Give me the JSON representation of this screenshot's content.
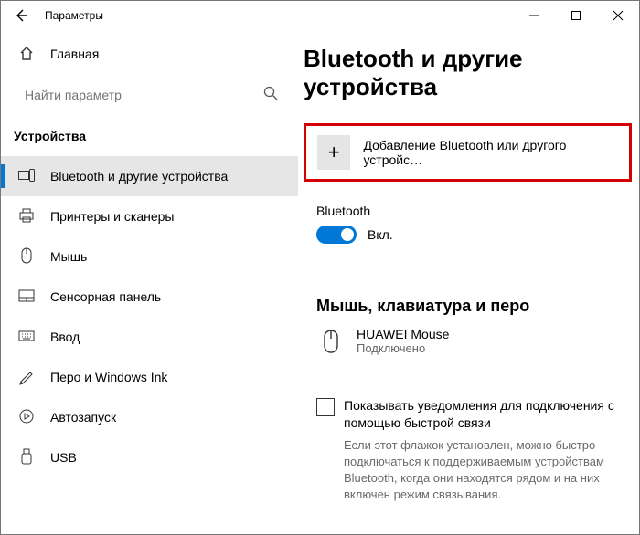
{
  "titlebar": {
    "app_title": "Параметры"
  },
  "sidebar": {
    "home_label": "Главная",
    "search_placeholder": "Найти параметр",
    "category": "Устройства",
    "items": [
      {
        "label": "Bluetooth и другие устройства",
        "active": true
      },
      {
        "label": "Принтеры и сканеры"
      },
      {
        "label": "Мышь"
      },
      {
        "label": "Сенсорная панель"
      },
      {
        "label": "Ввод"
      },
      {
        "label": "Перо и Windows Ink"
      },
      {
        "label": "Автозапуск"
      },
      {
        "label": "USB"
      }
    ]
  },
  "main": {
    "heading": "Bluetooth и другие устройства",
    "add_device_label": "Добавление Bluetooth или другого устройс…",
    "bt_section": "Bluetooth",
    "bt_state": "Вкл.",
    "mkp_heading": "Мышь, клавиатура и перо",
    "device_name": "HUAWEI  Mouse",
    "device_status": "Подключено",
    "checkbox_label": "Показывать уведомления для подключения с помощью быстрой связи",
    "checkbox_help": "Если этот флажок установлен, можно быстро подключаться к поддерживаемым устройствам Bluetooth, когда они находятся рядом и на них включен режим связывания."
  }
}
